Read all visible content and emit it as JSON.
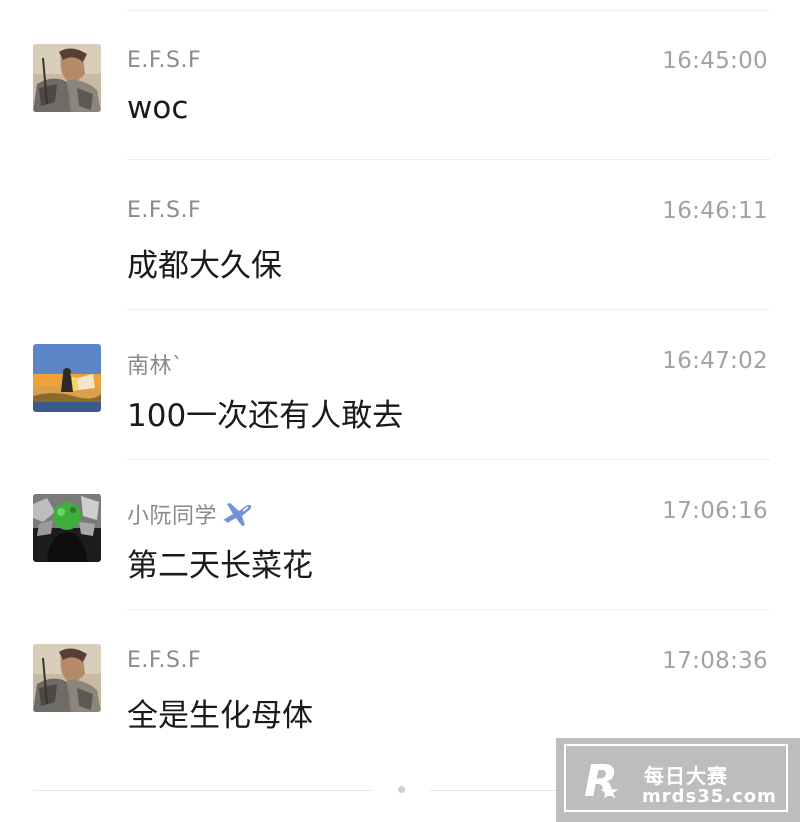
{
  "messages": [
    {
      "sender": "E.F.S.F",
      "time": "16:45:00",
      "text": "woc",
      "avatar": "armored-warrior-avatar"
    },
    {
      "sender": "E.F.S.F",
      "time": "16:46:11",
      "text": "成都大久保",
      "avatar": null
    },
    {
      "sender": "南林`",
      "time": "16:47:02",
      "text": "100一次还有人敢去",
      "avatar": "sunset-field-avatar"
    },
    {
      "sender": "小阮同学",
      "sender_icon": "airplane-icon",
      "time": "17:06:16",
      "text": "第二天长菜花",
      "avatar": "green-head-avatar"
    },
    {
      "sender": "E.F.S.F",
      "time": "17:08:36",
      "text": "全是生化母体",
      "avatar": "armored-warrior-avatar"
    }
  ],
  "watermark": {
    "title": "每日大赛",
    "url": "mrds35.com",
    "logo_letter": "R"
  },
  "colors": {
    "sender": "#8a8a8a",
    "time": "#a2a2a2",
    "text": "#1a1a1a",
    "divider": "#ececec",
    "watermark_bg": "#bdbdbd"
  }
}
